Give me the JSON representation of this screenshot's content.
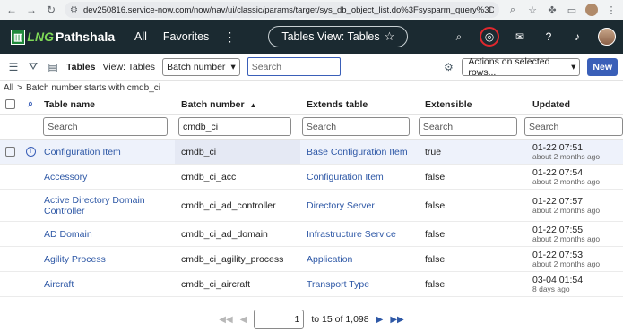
{
  "browser": {
    "url": "dev250816.service-now.com/now/nav/ui/classic/params/target/sys_db_object_list.do%3Fsysparm_query%3DnameSTARTSWITHcmdb..."
  },
  "header": {
    "logo_lng": "LNG",
    "logo_name": "Pathshala",
    "nav_all": "All",
    "nav_favorites": "Favorites",
    "context_pill": "Tables View: Tables"
  },
  "toolbar": {
    "title": "Tables",
    "view": "View: Tables",
    "field_select": "Batch number",
    "search_placeholder": "Search",
    "actions_label": "Actions on selected rows...",
    "new_label": "New"
  },
  "breadcrumb": {
    "all": "All",
    "separator": ">",
    "condition": "Batch number starts with cmdb_ci"
  },
  "table": {
    "columns": [
      "Table name",
      "Batch number",
      "Extends table",
      "Extensible",
      "Updated"
    ],
    "sort_indicator": "▲",
    "filters": {
      "table_name": "",
      "batch_number": "cmdb_ci",
      "extends_table": "",
      "extensible": "",
      "updated": ""
    },
    "filter_placeholder": "Search",
    "rows": [
      {
        "name": "Configuration Item",
        "batch": "cmdb_ci",
        "extends": "Base Configuration Item",
        "extensible": "true",
        "updated": "01-22 07:51",
        "ago": "about 2 months ago"
      },
      {
        "name": "Accessory",
        "batch": "cmdb_ci_acc",
        "extends": "Configuration Item",
        "extensible": "false",
        "updated": "01-22 07:54",
        "ago": "about 2 months ago"
      },
      {
        "name": "Active Directory Domain Controller",
        "batch": "cmdb_ci_ad_controller",
        "extends": "Directory Server",
        "extensible": "false",
        "updated": "01-22 07:57",
        "ago": "about 2 months ago"
      },
      {
        "name": "AD Domain",
        "batch": "cmdb_ci_ad_domain",
        "extends": "Infrastructure Service",
        "extensible": "false",
        "updated": "01-22 07:55",
        "ago": "about 2 months ago"
      },
      {
        "name": "Agility Process",
        "batch": "cmdb_ci_agility_process",
        "extends": "Application",
        "extensible": "false",
        "updated": "01-22 07:53",
        "ago": "about 2 months ago"
      },
      {
        "name": "Aircraft",
        "batch": "cmdb_ci_aircraft",
        "extends": "Transport Type",
        "extensible": "false",
        "updated": "03-04 01:54",
        "ago": "8 days ago"
      }
    ]
  },
  "pager": {
    "current": "1",
    "range_text": "to 15 of 1,098"
  },
  "colors": {
    "header_bg": "#1b2a31",
    "accent": "#3a5fb8",
    "link": "#2e58a6",
    "highlight_ring": "#e0282e"
  }
}
